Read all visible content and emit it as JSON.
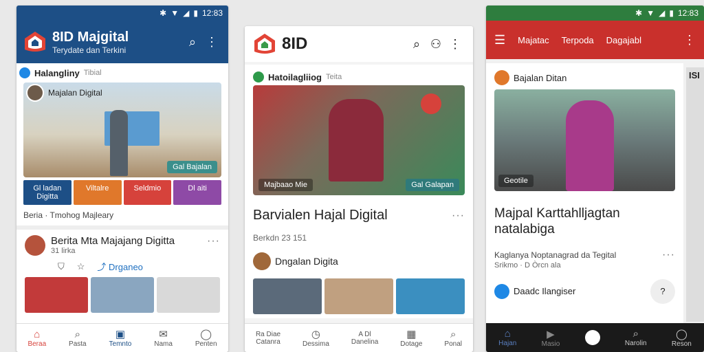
{
  "phone1": {
    "status": {
      "time": "12:83"
    },
    "brand": {
      "title": "8ID Majgital",
      "subtitle": "Terydate dan Terkini"
    },
    "section_label": "Halangliny",
    "section_meta": "Tibial",
    "feature": {
      "author": "Majalan Digital",
      "pill_text": "Gal Bajalan",
      "categories": [
        "Gl ladan Digitta",
        "Viltalre",
        "Seldmio",
        "Dl aiti"
      ],
      "category_colors": [
        "#1d4f86",
        "#e0782b",
        "#d6423b",
        "#8e4aa6"
      ],
      "footer": "Beria · Tmohog Majleary"
    },
    "post": {
      "title": "Berita Mta Majajang Digitta",
      "time": "31 lirka",
      "share_label": "Drganeo"
    },
    "bottom_nav": [
      "Beraa",
      "Pasta",
      "Temnto",
      "Nama",
      "Penten"
    ]
  },
  "phone2": {
    "brand": {
      "title": "8ID"
    },
    "section_label": "Hatoilagliiog",
    "section_meta": "Teita",
    "feature": {
      "caption": "Majbaao Mie",
      "pill_text": "Gal Galapan"
    },
    "headline": "Barvialen Hajal Digital",
    "meta": "Berkdn    23  151",
    "author": "Dngalan Digita",
    "bottom_nav": [
      "Ra Diae",
      "",
      "A Dl",
      "",
      ""
    ],
    "bottom_nav_sub": [
      "Catanra",
      "Dessima",
      "Danelina",
      "Dotage",
      "Ponal"
    ]
  },
  "phone3": {
    "status": {
      "time": "12:83"
    },
    "tabs": [
      "Majatac",
      "Terpoda",
      "Dagajabl"
    ],
    "section_label": "Bajalan Ditan",
    "feature": {
      "caption": "Geotile"
    },
    "headline": "Majpal Karttahlljagtan natalabiga",
    "sub": "Kaglanya Noptanagrad da Tegital",
    "sub2": "Srikmo · D Òrcn ala",
    "channel": "Daadc Ilangiser",
    "side_label": "ISI",
    "bottom_nav": [
      "Hajan",
      "Masio",
      "",
      "Narolin",
      "Reson"
    ]
  }
}
